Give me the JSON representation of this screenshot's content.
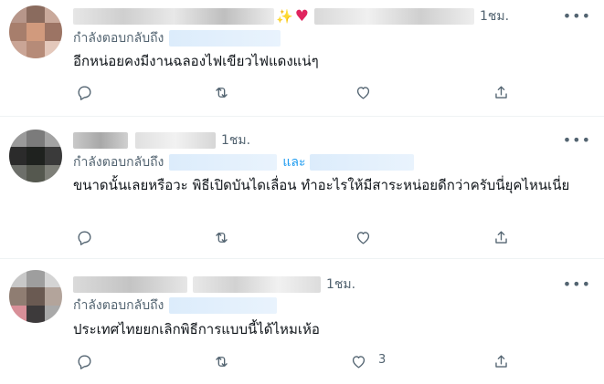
{
  "ui": {
    "reply_prefix": "กำลังตอบกลับถึง",
    "and_word": "และ",
    "more_glyph": "•••",
    "emoji_sparkles": "✨",
    "emoji_heart": "♥"
  },
  "tweets": [
    {
      "time": "1ชม.",
      "text": "อีกหน่อยคงมีงานฉลองไฟเขียวไฟแดงแน่ๆ",
      "like_count": ""
    },
    {
      "time": "1ชม.",
      "text": "ขนาดนั้นเลยหรือวะ พิธีเปิดบันไดเลื่อน ทำอะไรให้มีสาระหน่อยดีกว่าครับนี่ยุคไหนเนี่ย",
      "like_count": ""
    },
    {
      "time": "1ชม.",
      "text": "ประเทศไทยยกเลิกพิธีการแบบนี้ได้ไหมเห้อ",
      "like_count": "3"
    }
  ],
  "colors": {
    "text_primary": "#0f1419",
    "text_secondary": "#536471",
    "link_blue": "#1d9bf0",
    "heart_red": "#e0245e",
    "divider": "#eff3f4"
  },
  "icons": [
    "reply-icon",
    "retweet-icon",
    "like-icon",
    "share-icon",
    "more-icon"
  ]
}
